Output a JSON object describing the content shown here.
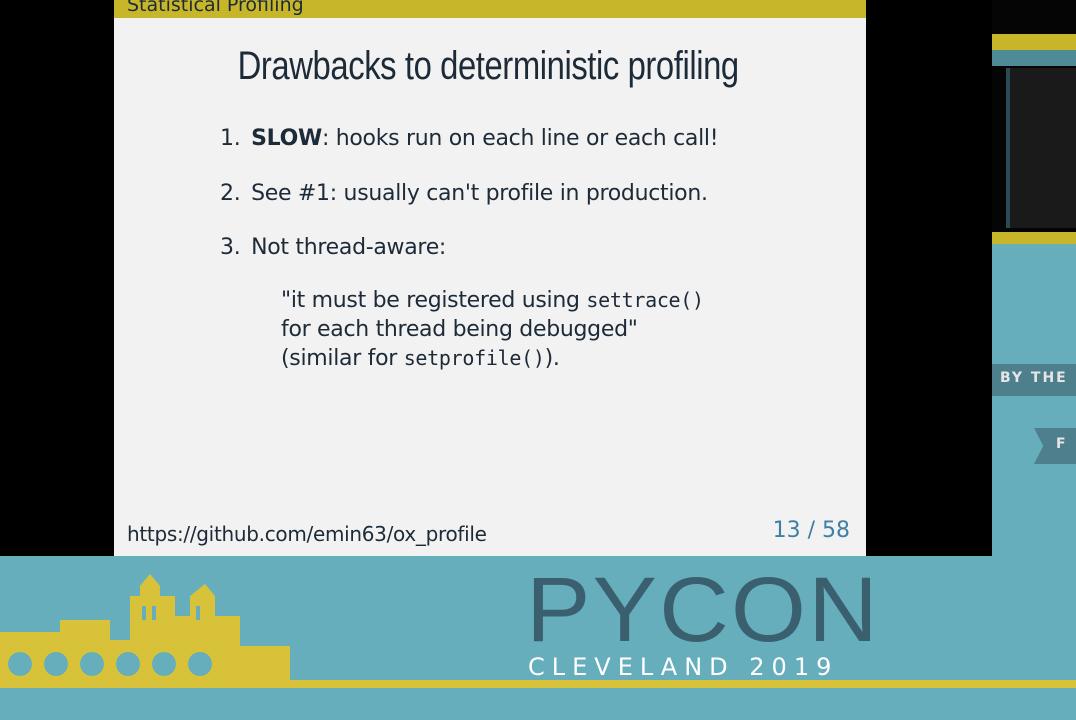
{
  "slide": {
    "section": "Statistical Profiling",
    "title": "Drawbacks to deterministic profiling",
    "items": [
      {
        "num": "1.",
        "bold": "SLOW",
        "text": ": hooks run on each line or each call!"
      },
      {
        "num": "2.",
        "text": "See #1: usually can't profile in production."
      },
      {
        "num": "3.",
        "text": "Not thread-aware:"
      }
    ],
    "quote": {
      "line1_text": "\"it must be registered using ",
      "line1_code": "settrace()",
      "line2_text": "for each thread being debugged\"",
      "line3_pre": "(similar for ",
      "line3_code": "setprofile()",
      "line3_post": ")."
    },
    "footer_url": "https://github.com/emin63/ox_profile",
    "page": "13 / 58"
  },
  "right_strip": {
    "text1": "BY THE",
    "text2": "F"
  },
  "banner": {
    "logo": "PYCON",
    "subtitle": "CLEVELAND 2019"
  },
  "colors": {
    "slide_bg": "#f2f2f2",
    "section_bar": "#c8b62a",
    "text_dark": "#1d2a38",
    "page_num": "#3d7fa5",
    "banner_teal": "#67aebc",
    "skyline_yellow": "#d8c23a"
  }
}
